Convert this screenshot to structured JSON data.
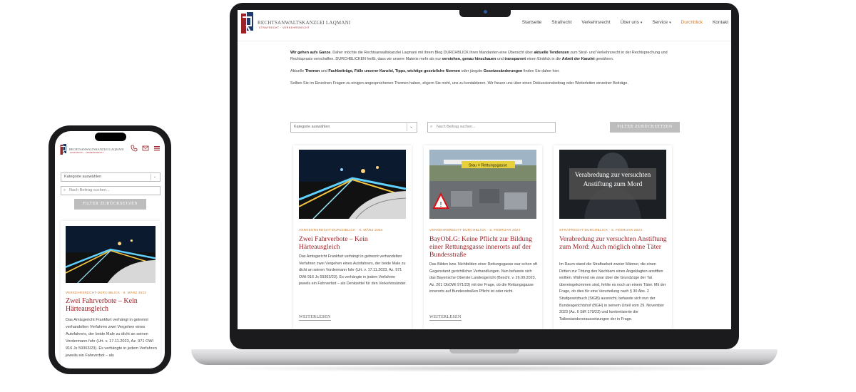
{
  "brand": {
    "name": "RECHTSANWALTSKANZLEI LAQMANI",
    "tagline": "STRAFRECHT · VERKEHRSRECHT"
  },
  "nav": {
    "items": [
      {
        "label": "Startseite"
      },
      {
        "label": "Strafrecht"
      },
      {
        "label": "Verkehrsrecht"
      },
      {
        "label": "Über uns"
      },
      {
        "label": "Service"
      },
      {
        "label": "Durchblick"
      },
      {
        "label": "Kontakt"
      }
    ]
  },
  "intro": {
    "p1_b1": "Wir gehen aufs Ganze",
    "p1_t1": ". Daher möchte die Rechtsanwaltskanzlei Laqmani mit ihrem Blog DURCHBLICK ihren Mandanten eine Übersicht über ",
    "p1_b2": "aktuelle Tendenzen",
    "p1_t2": " zum Straf- und Verkehrsrecht in der Rechtsprechung und Rechtspraxis verschaffen. DURCHBLICKEN heißt, dass wir unsere Materie mehr als nur ",
    "p1_b3": "verstehen, genau hinschauen",
    "p1_t3": " und ",
    "p1_b4": "transparent",
    "p1_t4": " einen Einblick in die ",
    "p1_b5": "Arbeit der Kanzlei",
    "p1_t5": " gewähren.",
    "p2_t1": "Aktuelle ",
    "p2_b1": "Themen",
    "p2_t2": " und ",
    "p2_b2": "Fachbeiträge, Fälle unserer Kanzlei, Tipps, wichtige gesetzliche Normen",
    "p2_t3": " oder jüngste ",
    "p2_b3": "Gesetzesänderungen",
    "p2_t4": " finden Sie daher hier.",
    "p3": "Sollten Sie im Einzelnen Fragen zu einigen angesprochenen Themen haben, zögern Sie nicht, uns zu kontaktieren. Wir freuen uns über einen Diskussionsbeitrag oder Weiterleiten einzelner Beiträge."
  },
  "filters": {
    "category_value": "Kategorie auswählen",
    "search_placeholder": "Nach Beitrag suchen...",
    "button_label": "FILTER ZURÜCKSETZEN"
  },
  "posts": [
    {
      "meta": "VERKEHRSRECHT-DURCHBLICK · 8. MÄRZ 2024",
      "title": "Zwei Fahrverbote – Kein Härteausgleich",
      "excerpt": "Das Amtsgericht Frankfurt verhängt in getrennt verhandelten Verfahren zwei Vergehen eines Autofahrers, der beide Male zu dicht an seinen Vordermann fuhr (Urt. v. 17.11.2023, Az. 971 OWi 916 Js 59363/23). Es verhängte in jedem Verfahren jeweils ein Fahrverbot – als Denkzettel für den Verkehrssünder.",
      "more": "WEITERLESEN"
    },
    {
      "meta": "VERKEHRSRECHT-DURCHBLICK · 8. FEBRUAR 2024",
      "title": "BayObLG: Keine Pflicht zur Bildung einer Rettungsgasse innerorts auf der Bundesstraße",
      "excerpt": "Das Bilden bzw. Nichtbilden einer Rettungsgasse war schon oft Gegenstand gerichtlicher Verhandlungen. Nun befasste sich das Bayerische Oberste Landesgericht (Beschl. v. 26.09.2023, Az. 201 ObOWi 971/23) mit der Frage, ob die Rettungsgasse innerorts auf Bundesstraßen Pflicht ist oder nicht.",
      "more": "WEITERLESEN",
      "sign_text": "Stau = Rettungsgasse"
    },
    {
      "meta": "STRAFRECHT-DURCHBLICK · 5. FEBRUAR 2024",
      "title": "Verabredung zur versuchten Anstiftung zum Mord: Auch möglich ohne Täter",
      "image_caption": "Verabredung zur versuchten Anstiftung zum Mord",
      "excerpt": "Im Raum stand die Strafbarkeit zweier Männer, die einen Dritten zur Tötung des Nachbarn eines Angeklagten anstiften wollten. Während sie zwar über die Grundzüge der Tat übereingekommen sind, fehlte es noch an einem Täter. Mit der Frage, ob dies für eine Verurteilung nach § 30 Abs. 2 Strafgesetzbuch (StGB) ausreicht, befasste sich nun der Bundesgerichtshof (BGH) in seinem Urteil vom 29. November 2023 (Az. 6 StR 179/23) und konkretisierte die Tatbestandsvoraussetzungen der in Frage.",
      "more": ""
    }
  ],
  "mobile": {
    "category_value": "Kategorie auswählen",
    "search_placeholder": "Nach Beitrag suchen...",
    "button_label": "FILTER ZURÜCKSETZEN",
    "post": {
      "meta": "VERKEHRSRECHT-DURCHBLICK · 8. MÄRZ 2024",
      "title": "Zwei Fahrverbote – Kein Härteausgleich",
      "excerpt": "Das Amtsgericht Frankfurt verhängt in getrennt verhandelten Verfahren zwei Vergehen eines Autofahrers, der beide Male zu dicht an seinen Vordermann fuhr (Urt. v. 17.11.2023, Az. 971 OWi 916 Js 59363/23). Es verhängte in jedem Verfahren jeweils ein Fahrverbot – als"
    }
  },
  "colors": {
    "accent": "#9b2226",
    "meta": "#d17a2a",
    "button": "#bdbdbd"
  }
}
